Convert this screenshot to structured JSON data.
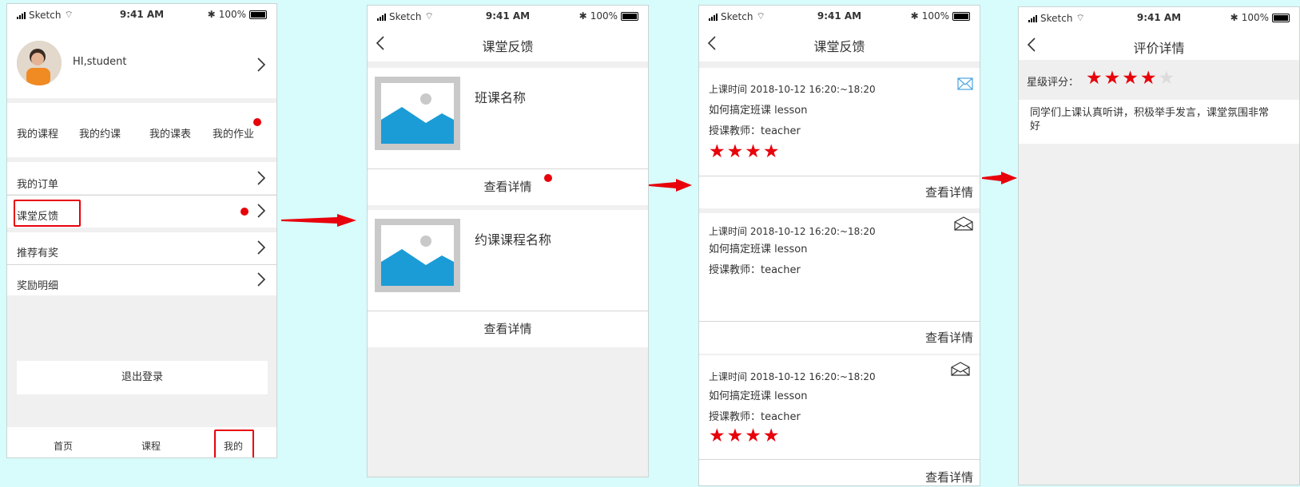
{
  "status_bar": {
    "carrier": "Sketch",
    "time": "9:41 AM",
    "battery": "100%"
  },
  "screen1": {
    "greeting": "HI,student",
    "menu": [
      "我的课程",
      "我的约课",
      "我的课表",
      "我的作业"
    ],
    "list": [
      "我的订单",
      "课堂反馈",
      "推荐有奖",
      "奖励明细"
    ],
    "logout": "退出登录",
    "tabs": [
      "首页",
      "课程",
      "我的"
    ]
  },
  "screen2": {
    "title": "课堂反馈",
    "cards": [
      {
        "name": "班课名称",
        "action": "查看详情"
      },
      {
        "name": "约课课程名称",
        "action": "查看详情"
      }
    ]
  },
  "screen3": {
    "title": "课堂反馈",
    "items": [
      {
        "time_label": "上课时间 2018-10-12  16:20:~18:20",
        "course": "如何搞定班课 lesson",
        "teacher": "授课教师：teacher",
        "rating": 4,
        "action": "查看详情",
        "icon": "mail-icon"
      },
      {
        "time_label": "上课时间 2018-10-12  16:20:~18:20",
        "course": "如何搞定班课 lesson",
        "teacher": "授课教师：teacher",
        "rating": 0,
        "action": "查看详情",
        "icon": "mail-open-icon"
      },
      {
        "time_label": "上课时间 2018-10-12  16:20:~18:20",
        "course": "如何搞定班课 lesson",
        "teacher": "授课教师：teacher",
        "rating": 4,
        "action": "查看详情",
        "icon": "mail-open-icon"
      }
    ]
  },
  "screen4": {
    "title": "评价详情",
    "rating_label": "星级评分：",
    "rating": 4,
    "rating_max": 5,
    "comment": "同学们上课认真听讲，积极举手发言，课堂氛围非常好"
  },
  "colors": {
    "background": "#d8fbfb",
    "accent_red": "#e8000b",
    "image_blue": "#1b9cd6",
    "mail_blue": "#4aa3df"
  }
}
